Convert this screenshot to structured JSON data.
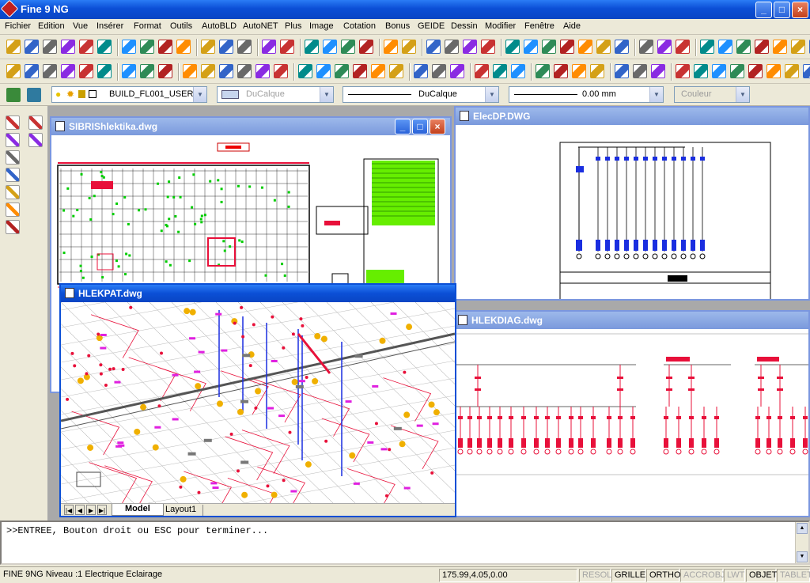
{
  "window": {
    "title": "Fine 9 NG",
    "minimize": "_",
    "maximize": "□",
    "close": "×"
  },
  "menu": [
    "Fichier",
    "Edition",
    "Vue",
    "Insérer",
    "Format",
    "Outils",
    "AutoBLD",
    "AutoNET",
    "Plus",
    "Image",
    "Cotation",
    "Bonus",
    "GEIDE",
    "Dessin",
    "Modifier",
    "Fenêtre",
    "Aide"
  ],
  "properties": {
    "layer": "BUILD_FL001_USER",
    "color_layer": "DuCalque",
    "linetype": "DuCalque",
    "lineweight": "0.00 mm",
    "plotstyle": "Couleur"
  },
  "documents": {
    "sibris": {
      "title": "SIBRIShlektika.dwg"
    },
    "elecdp": {
      "title": "ElecDP.DWG"
    },
    "hlekpat": {
      "title": "HLEKPAT.dwg",
      "tab_model": "Model",
      "tab_layout": "Layout1"
    },
    "hlekdiag": {
      "title": "HLEKDIAG.dwg"
    }
  },
  "command": {
    "prompt": ">>ENTREE, Bouton droit ou ESC pour terminer..."
  },
  "status": {
    "app": "FINE 9NG Niveau :1  Electrique Eclairage",
    "coords": "175.99,4.05,0.00",
    "toggles": [
      {
        "label": "RESOL",
        "on": false
      },
      {
        "label": "GRILLE",
        "on": true
      },
      {
        "label": "ORTHO",
        "on": true
      },
      {
        "label": "ACCROBJ",
        "on": false
      },
      {
        "label": "LWT",
        "on": false
      },
      {
        "label": "OBJET",
        "on": true
      },
      {
        "label": "TABLET",
        "on": false
      }
    ]
  },
  "colors": {
    "accent": "#0b4fd6",
    "drawing_red": "#e8103a",
    "drawing_blue": "#1a2ee0",
    "drawing_green": "#66ee00",
    "drawing_magenta": "#e020e0",
    "drawing_orange": "#f0b000"
  }
}
